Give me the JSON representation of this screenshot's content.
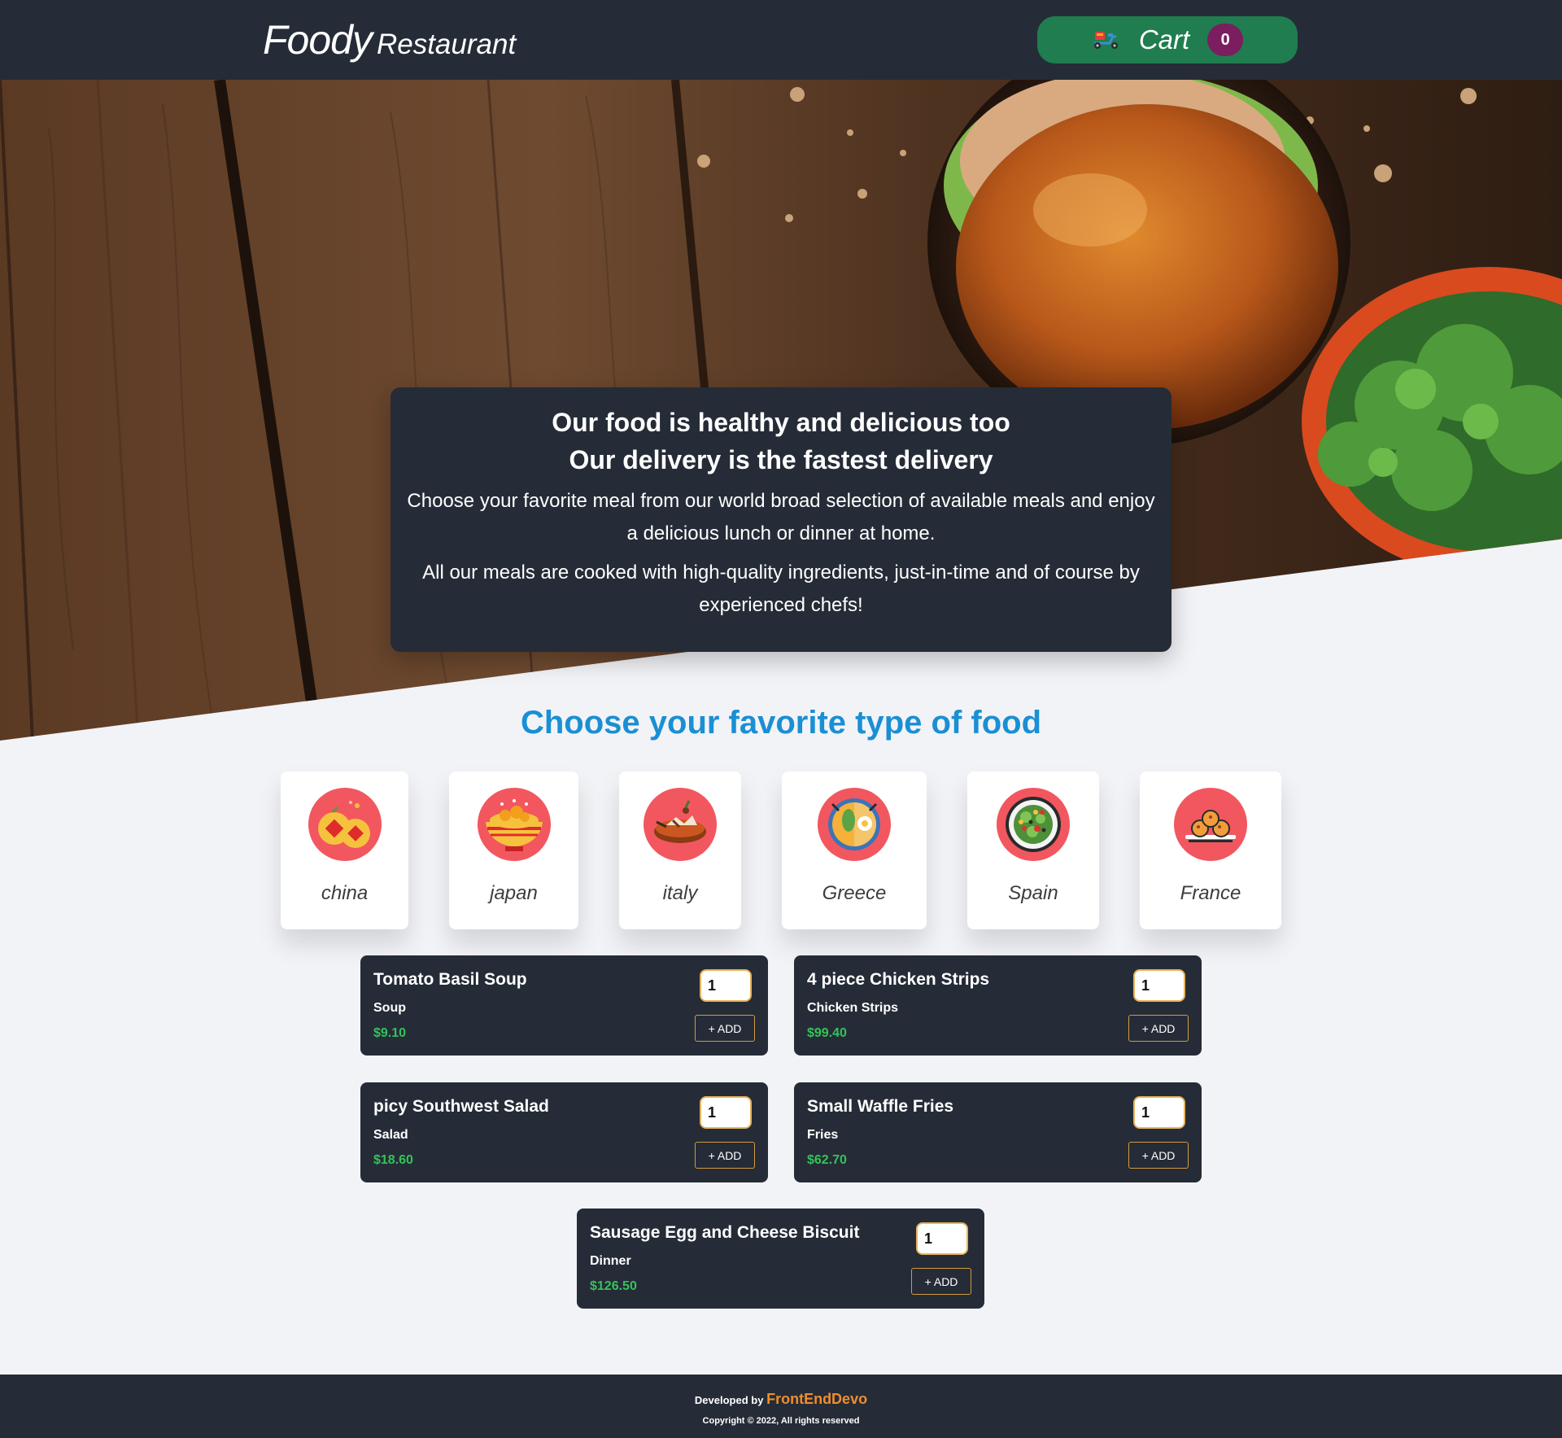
{
  "header": {
    "logo_main": "Foody",
    "logo_sub": "Restaurant",
    "cart_label": "Cart",
    "cart_count": "0",
    "cart_icon": "delivery-scooter-icon"
  },
  "hero": {
    "headline_1": "Our food is healthy and delicious too",
    "headline_2": "Our delivery is the fastest delivery",
    "paragraph_1": "Choose your favorite meal from our world broad selection of available meals and enjoy a delicious lunch or dinner at home.",
    "paragraph_2": "All our meals are cooked with high-quality ingredients, just-in-time and of course by experienced chefs!"
  },
  "types": {
    "title": "Choose your favorite type of food",
    "items": [
      {
        "label": "china",
        "icon": "chinese-food-icon"
      },
      {
        "label": "japan",
        "icon": "noodle-bowl-icon"
      },
      {
        "label": "italy",
        "icon": "italian-dish-icon"
      },
      {
        "label": "Greece",
        "icon": "greek-plate-icon"
      },
      {
        "label": "Spain",
        "icon": "salad-bowl-icon"
      },
      {
        "label": "France",
        "icon": "pastry-plate-icon"
      }
    ]
  },
  "meals": [
    {
      "name": "Tomato Basil Soup",
      "category": "Soup",
      "price": "$9.10",
      "qty": "1",
      "button": "+ ADD"
    },
    {
      "name": "4 piece Chicken Strips",
      "category": "Chicken Strips",
      "price": "$99.40",
      "qty": "1",
      "button": "+ ADD"
    },
    {
      "name": "picy Southwest Salad",
      "category": "Salad",
      "price": "$18.60",
      "qty": "1",
      "button": "+ ADD"
    },
    {
      "name": "Small Waffle Fries",
      "category": "Fries",
      "price": "$62.70",
      "qty": "1",
      "button": "+ ADD"
    },
    {
      "name": "Sausage Egg and Cheese Biscuit",
      "category": "Dinner",
      "price": "$126.50",
      "qty": "1",
      "button": "+ ADD"
    }
  ],
  "footer": {
    "developed_by": "Developed by",
    "developer": "FrontEndDevo",
    "copyright": "Copyright © 2022, All rights reserved"
  },
  "colors": {
    "header_bg": "#252c37",
    "cart_bg": "#1f7d4f",
    "cart_badge": "#7b1e60",
    "title_blue": "#1a8fd4",
    "price_green": "#35c25a",
    "icon_circle": "#f2575f",
    "developer_orange": "#f08d2d"
  }
}
